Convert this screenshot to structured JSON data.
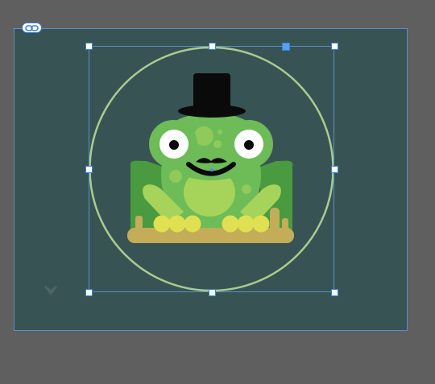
{
  "canvas": {
    "background": "#385354",
    "border_color": "#5b8fcb",
    "page_background": "#5f5f5f"
  },
  "toolbar": {
    "link_icon": "link-icon",
    "chevron_icon": "chevron-down-icon"
  },
  "selection": {
    "handle_color": "#ffffff",
    "rotate_handle_color": "#5aa0f0",
    "handles": [
      "top-left",
      "top-center",
      "top-right",
      "middle-left",
      "middle-right",
      "bottom-left",
      "bottom-center",
      "bottom-right"
    ]
  },
  "artwork": {
    "subject": "frog-with-top-hat-and-mustache",
    "ring_color": "#a9cc8f",
    "frog_color": "#6dbc57",
    "belly_color": "#a6d35a",
    "hat_color": "#0a0a0a",
    "log_color": "#c3ad58",
    "toe_color": "#e0e052"
  }
}
